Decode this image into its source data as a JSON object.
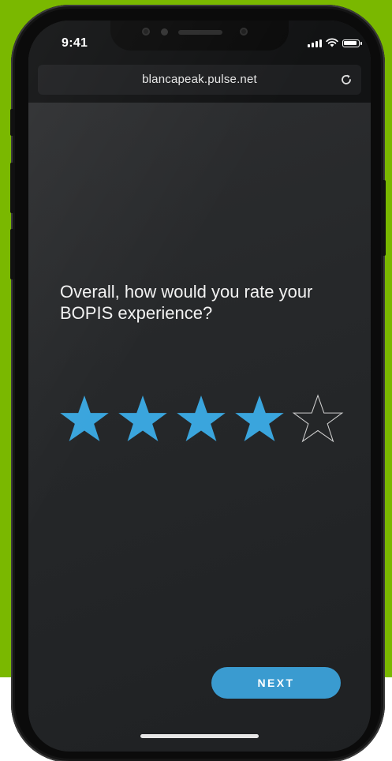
{
  "status_bar": {
    "time": "9:41",
    "signal_icon": "cellular-signal-icon",
    "wifi_icon": "wifi-icon",
    "battery_icon": "battery-icon"
  },
  "browser": {
    "url": "blancapeak.pulse.net",
    "reload_icon": "reload-icon"
  },
  "survey": {
    "question": "Overall, how would you rate your BOPIS experience?",
    "rating": {
      "value": 4,
      "max": 5
    },
    "next_label": "NEXT"
  },
  "colors": {
    "background_green": "#7ab800",
    "accent_blue": "#3a9bd0",
    "star_filled": "#3aa5dd",
    "star_outline": "#d0d0d0"
  }
}
